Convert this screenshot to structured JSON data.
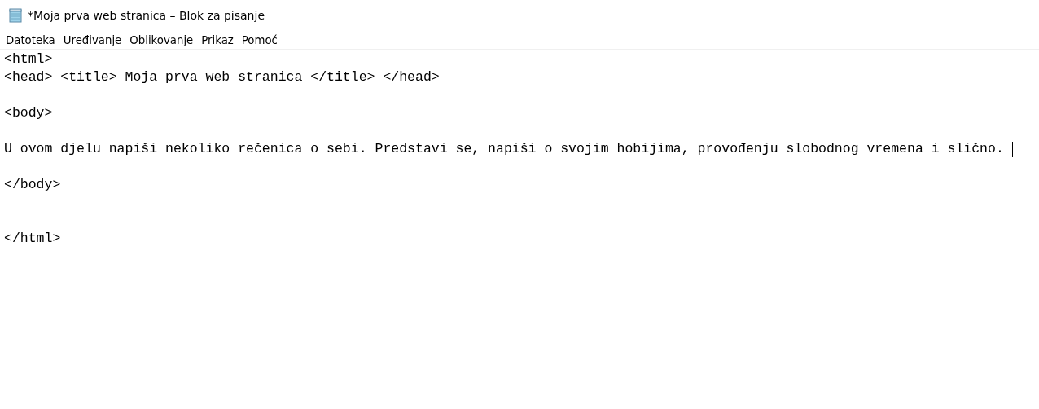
{
  "window": {
    "title": "*Moja prva web stranica – Blok za pisanje"
  },
  "menu": [
    "Datoteka",
    "Uređivanje",
    "Oblikovanje",
    "Prikaz",
    "Pomoć"
  ],
  "editor": {
    "lines": [
      {
        "kind": "text",
        "text": "<html>",
        "cursor": false
      },
      {
        "kind": "text",
        "text": "<head> <title> Moja prva web stranica </title> </head>",
        "cursor": false
      },
      {
        "kind": "blank"
      },
      {
        "kind": "text",
        "text": "<body>",
        "cursor": false
      },
      {
        "kind": "blank"
      },
      {
        "kind": "text",
        "text": "U ovom djelu napiši nekoliko rečenica o sebi. Predstavi se, napiši o svojim hobijima, provođenju slobodnog vremena i slično.",
        "cursor": true
      },
      {
        "kind": "blank"
      },
      {
        "kind": "text",
        "text": "</body>",
        "cursor": false
      },
      {
        "kind": "blank"
      },
      {
        "kind": "blank"
      },
      {
        "kind": "text",
        "text": "</html>",
        "cursor": false
      }
    ]
  }
}
